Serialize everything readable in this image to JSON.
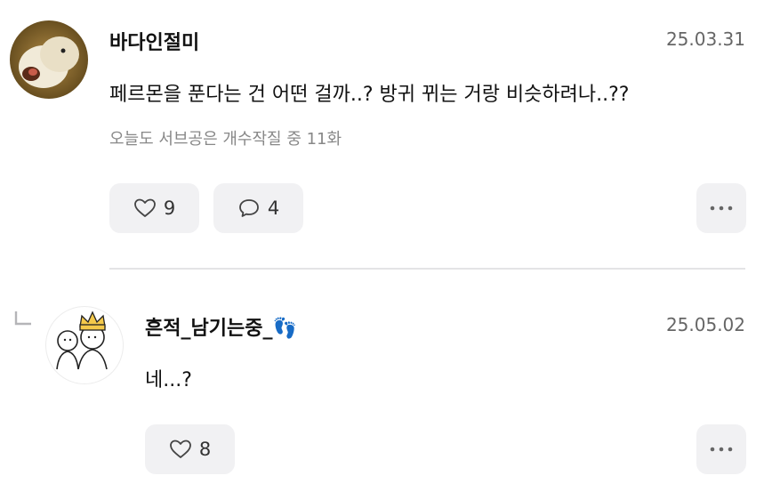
{
  "comments": [
    {
      "username": "바다인절미",
      "date": "25.03.31",
      "text": "페르몬을 푼다는 건 어떤 걸까..? 방귀 뀌는 거랑 비슷하려나..??",
      "meta": "오늘도 서브공은 개수작질 중 11화",
      "likes": "9",
      "comments": "4"
    },
    {
      "username": "흔적_남기는중_👣",
      "date": "25.05.02",
      "text": "네...?",
      "likes": "8"
    }
  ],
  "colors": {
    "pill_bg": "#f1f1f3",
    "divider": "#e4e4e6",
    "muted_text": "#888888"
  },
  "icons": [
    "heart-icon",
    "speech-bubble-icon",
    "more-dots-icon",
    "reply-arrow-icon"
  ]
}
